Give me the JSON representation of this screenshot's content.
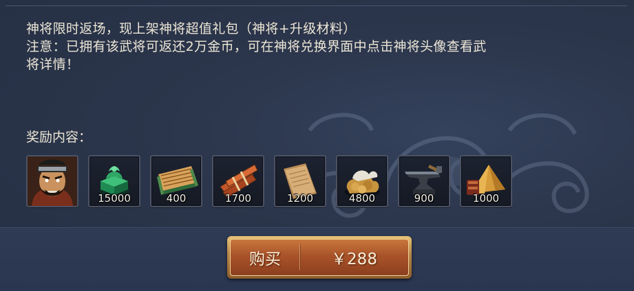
{
  "description": {
    "line1": "神将限时返场，现上架神将超值礼包（神将+升级材料）",
    "line2": "注意：已拥有该武将可返还2万金币，可在神将兑换界面中点击神将头像查看武",
    "line3": "将详情！"
  },
  "rewards": {
    "label": "奖励内容：",
    "items": [
      {
        "icon": "general-portrait-icon",
        "quantity": ""
      },
      {
        "icon": "jade-seal-icon",
        "quantity": "15000"
      },
      {
        "icon": "bamboo-scroll-icon",
        "quantity": "400"
      },
      {
        "icon": "wood-bundle-icon",
        "quantity": "1700"
      },
      {
        "icon": "parchment-icon",
        "quantity": "1200"
      },
      {
        "icon": "ore-pile-icon",
        "quantity": "4800"
      },
      {
        "icon": "anvil-icon",
        "quantity": "900"
      },
      {
        "icon": "tent-icon",
        "quantity": "1000"
      }
    ]
  },
  "buy_button": {
    "label": "购买",
    "price": "￥288"
  },
  "colors": {
    "panel_bg": "#2b354b",
    "text": "#ece6d6",
    "button_orange": "#a9532a",
    "button_gold_frame": "#e8c377"
  }
}
